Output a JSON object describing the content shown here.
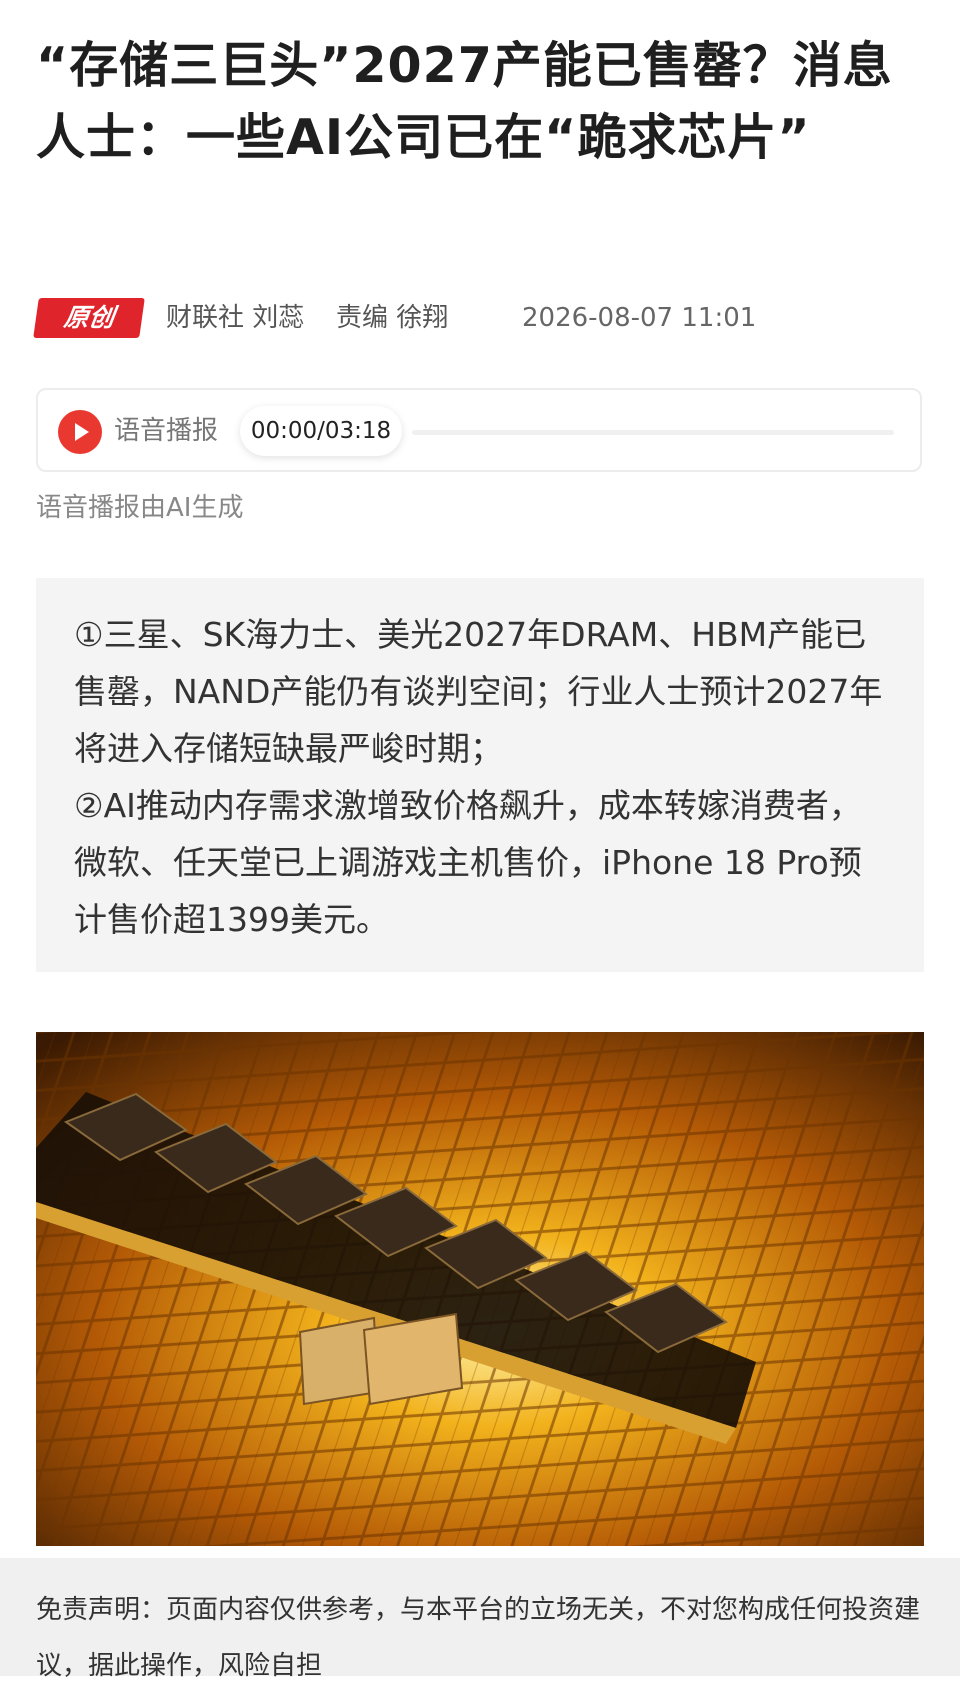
{
  "article": {
    "title": "“存储三巨头”2027产能已售罄？消息人士：一些AI公司已在“跪求芯片”",
    "badge": "原创",
    "source": "财联社 刘蕊",
    "editor": "责编 徐翔",
    "datetime": "2026-08-07 11:01"
  },
  "audio": {
    "label": "语音播报",
    "time": "00:00/03:18",
    "progress": 0,
    "note": "语音播报由AI生成"
  },
  "summary": {
    "point1": "①三星、SK海力士、美光2027年DRAM、HBM产能已售罄，NAND产能仍有谈判空间；行业人士预计2027年将进入存储短缺最严峻时期；",
    "point2": "②AI推动内存需求激增致价格飙升，成本转嫁消费者，微软、任天堂已上调游戏主机售价，iPhone 18 Pro预计售价超1399美元。"
  },
  "image": {
    "subject": "memory-module-photo"
  },
  "disclaimer": "免责声明：页面内容仅供参考，与本平台的立场无关，不对您构成任何投资建议，据此操作，风险自担",
  "colors": {
    "accent": "#e0242b",
    "play": "#e9382f",
    "summary_bg": "#f4f4f4",
    "footer_bg": "#f0f0f0"
  }
}
